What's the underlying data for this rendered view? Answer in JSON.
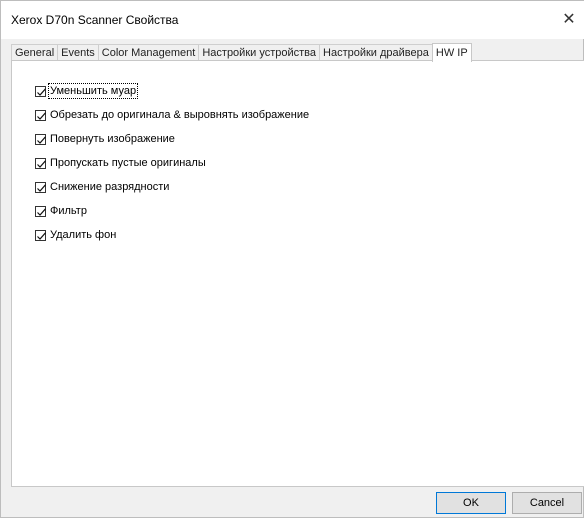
{
  "window": {
    "title": "Xerox D70n Scanner Свойства",
    "close_glyph": "✕"
  },
  "tabs": [
    {
      "label": "General",
      "active": false
    },
    {
      "label": "Events",
      "active": false
    },
    {
      "label": "Color Management",
      "active": false
    },
    {
      "label": "Настройки устройства",
      "active": false
    },
    {
      "label": "Настройки драйвера",
      "active": false
    },
    {
      "label": "HW IP",
      "active": true
    }
  ],
  "options": [
    {
      "label": "Уменьшить муар",
      "checked": true,
      "focused": true
    },
    {
      "label": "Обрезать до оригинала & выровнять изображение",
      "checked": true,
      "focused": false
    },
    {
      "label": "Повернуть изображение",
      "checked": true,
      "focused": false
    },
    {
      "label": "Пропускать пустые оригиналы",
      "checked": true,
      "focused": false
    },
    {
      "label": "Снижение разрядности",
      "checked": true,
      "focused": false
    },
    {
      "label": "Фильтр",
      "checked": true,
      "focused": false
    },
    {
      "label": "Удалить фон",
      "checked": true,
      "focused": false
    }
  ],
  "buttons": {
    "ok_label": "OK",
    "cancel_label": "Cancel"
  }
}
